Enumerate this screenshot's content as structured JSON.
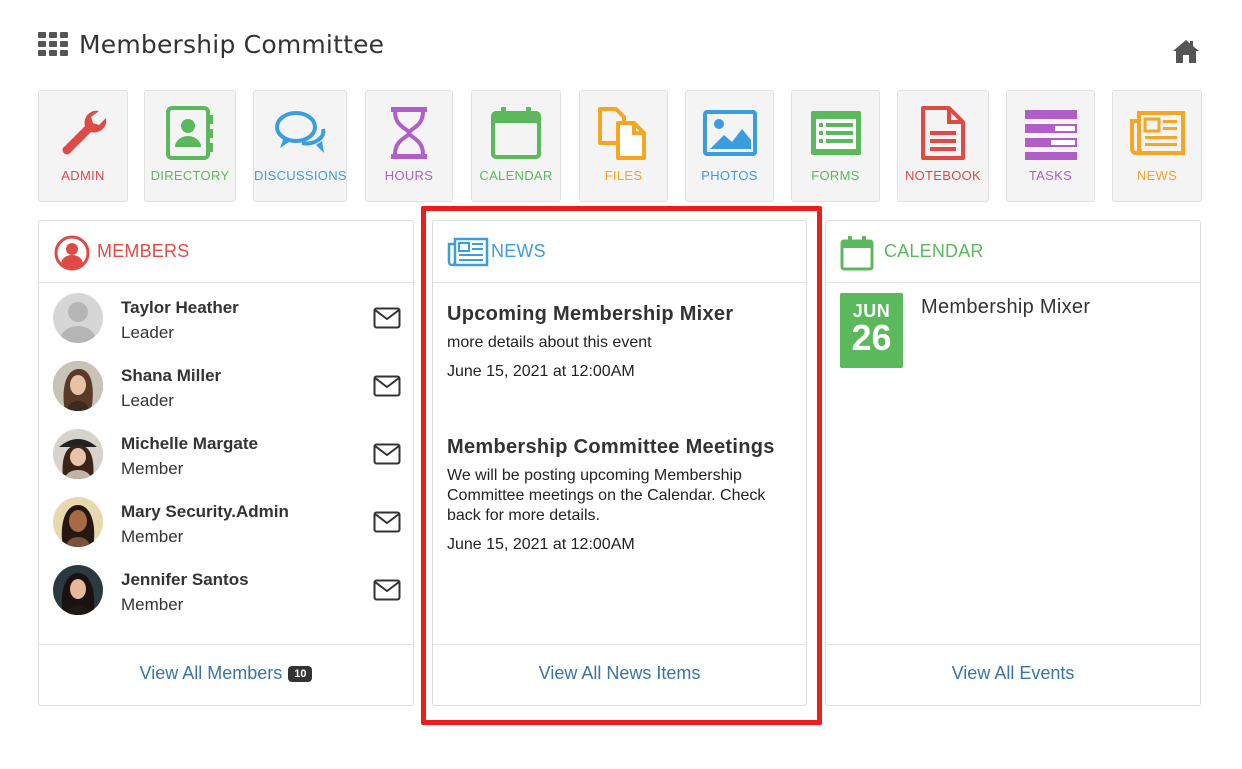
{
  "header": {
    "title": "Membership Committee",
    "grid_icon": "grid-icon",
    "home_icon": "home-icon"
  },
  "tiles": [
    {
      "label": "ADMIN",
      "icon": "wrench-icon",
      "color": "#e04a46"
    },
    {
      "label": "DIRECTORY",
      "icon": "address-book-icon",
      "color": "#5cb85c"
    },
    {
      "label": "DISCUSSIONS",
      "icon": "chat-bubbles-icon",
      "color": "#3a9de0"
    },
    {
      "label": "HOURS",
      "icon": "hourglass-icon",
      "color": "#b05fc8"
    },
    {
      "label": "CALENDAR",
      "icon": "calendar-icon",
      "color": "#5cb85c"
    },
    {
      "label": "FILES",
      "icon": "files-icon",
      "color": "#f5a623"
    },
    {
      "label": "PHOTOS",
      "icon": "photo-icon",
      "color": "#3a9de0"
    },
    {
      "label": "FORMS",
      "icon": "form-icon",
      "color": "#5cb85c"
    },
    {
      "label": "NOTEBOOK",
      "icon": "notebook-icon",
      "color": "#e04a46"
    },
    {
      "label": "TASKS",
      "icon": "tasks-icon",
      "color": "#b05fc8"
    },
    {
      "label": "NEWS",
      "icon": "newspaper-icon",
      "color": "#f5a623"
    }
  ],
  "members_panel": {
    "title": "MEMBERS",
    "color": "#e04a46",
    "members": [
      {
        "name": "Taylor Heather",
        "role": "Leader"
      },
      {
        "name": "Shana Miller",
        "role": "Leader"
      },
      {
        "name": "Michelle Margate",
        "role": "Member"
      },
      {
        "name": "Mary Security.Admin",
        "role": "Member"
      },
      {
        "name": "Jennifer Santos",
        "role": "Member"
      }
    ],
    "footer_link": "View All Members",
    "count": "10"
  },
  "news_panel": {
    "title": "NEWS",
    "color": "#3a9de0",
    "items": [
      {
        "title": "Upcoming Membership Mixer",
        "description": "more details about this event",
        "date": "June 15, 2021 at 12:00AM"
      },
      {
        "title": "Membership Committee Meetings",
        "description": "We will be posting upcoming Membership Committee meetings on the Calendar. Check back for more details.",
        "date": "June 15, 2021 at 12:00AM"
      }
    ],
    "footer_link": "View All News Items"
  },
  "calendar_panel": {
    "title": "CALENDAR",
    "color": "#5cb85c",
    "event": {
      "month": "JUN",
      "day": "26",
      "title": "Membership Mixer"
    },
    "footer_link": "View All Events"
  },
  "highlight_color": "#ee1c1c"
}
